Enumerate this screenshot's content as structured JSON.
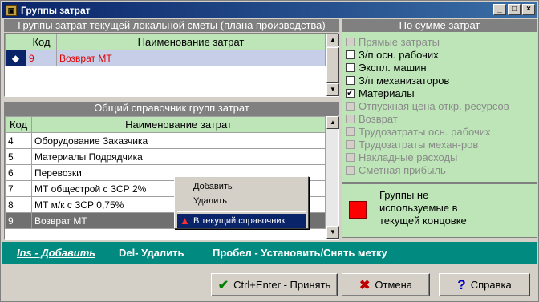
{
  "window": {
    "title": "Группы затрат",
    "min_label": "_",
    "max_label": "□",
    "close_label": "×"
  },
  "top_panel": {
    "title": "Группы затрат текущей локальной сметы (плана производства)",
    "col_code": "Код",
    "col_name": "Наименование затрат",
    "rows": [
      {
        "code": "9",
        "name": "Возврат МТ"
      }
    ]
  },
  "bottom_panel": {
    "title": "Общий справочник групп затрат",
    "col_code": "Код",
    "col_name": "Наименование затрат",
    "rows": [
      {
        "code": "4",
        "name": "Оборудование Заказчика"
      },
      {
        "code": "5",
        "name": "Материалы Подрядчика"
      },
      {
        "code": "6",
        "name": "Перевозки"
      },
      {
        "code": "7",
        "name": "МТ общестрой с ЗСР 2%"
      },
      {
        "code": "8",
        "name": "МТ м/к с ЗСР 0,75%"
      },
      {
        "code": "9",
        "name": "Возврат МТ"
      }
    ]
  },
  "sum_panel": {
    "title": "По сумме затрат",
    "items": [
      {
        "label": "Прямые затраты",
        "checked": false,
        "enabled": false
      },
      {
        "label": "З/п осн. рабочих",
        "checked": false,
        "enabled": true
      },
      {
        "label": "Экспл. машин",
        "checked": false,
        "enabled": true
      },
      {
        "label": "З/п механизаторов",
        "checked": false,
        "enabled": true
      },
      {
        "label": "Материалы",
        "checked": true,
        "enabled": true
      },
      {
        "label": "Отпускная цена откр. ресурсов",
        "checked": false,
        "enabled": false
      },
      {
        "label": "Возврат",
        "checked": false,
        "enabled": false
      },
      {
        "label": "Трудозатраты осн. рабочих",
        "checked": false,
        "enabled": false
      },
      {
        "label": "Трудозатраты механ-ров",
        "checked": false,
        "enabled": false
      },
      {
        "label": "Накладные расходы",
        "checked": false,
        "enabled": false
      },
      {
        "label": "Сметная прибыль",
        "checked": false,
        "enabled": false
      }
    ]
  },
  "legend": {
    "text": "Группы не используемые в текущей концовке",
    "color": "#ff0000"
  },
  "hotkeys": {
    "ins": "Ins - Добавить",
    "del": "Del- Удалить",
    "space": "Пробел - Установить/Снять метку"
  },
  "buttons": {
    "accept": "Ctrl+Enter - Принять",
    "cancel": "Отмена",
    "help": "Справка"
  },
  "context_menu": {
    "add": "Добавить",
    "delete": "Удалить",
    "to_current": "В текущий справочник"
  },
  "colors": {
    "accent_green": "#bde5b8",
    "hotbar": "#008a80",
    "titlebar": "#0a246a",
    "red_text": "#e00000"
  }
}
